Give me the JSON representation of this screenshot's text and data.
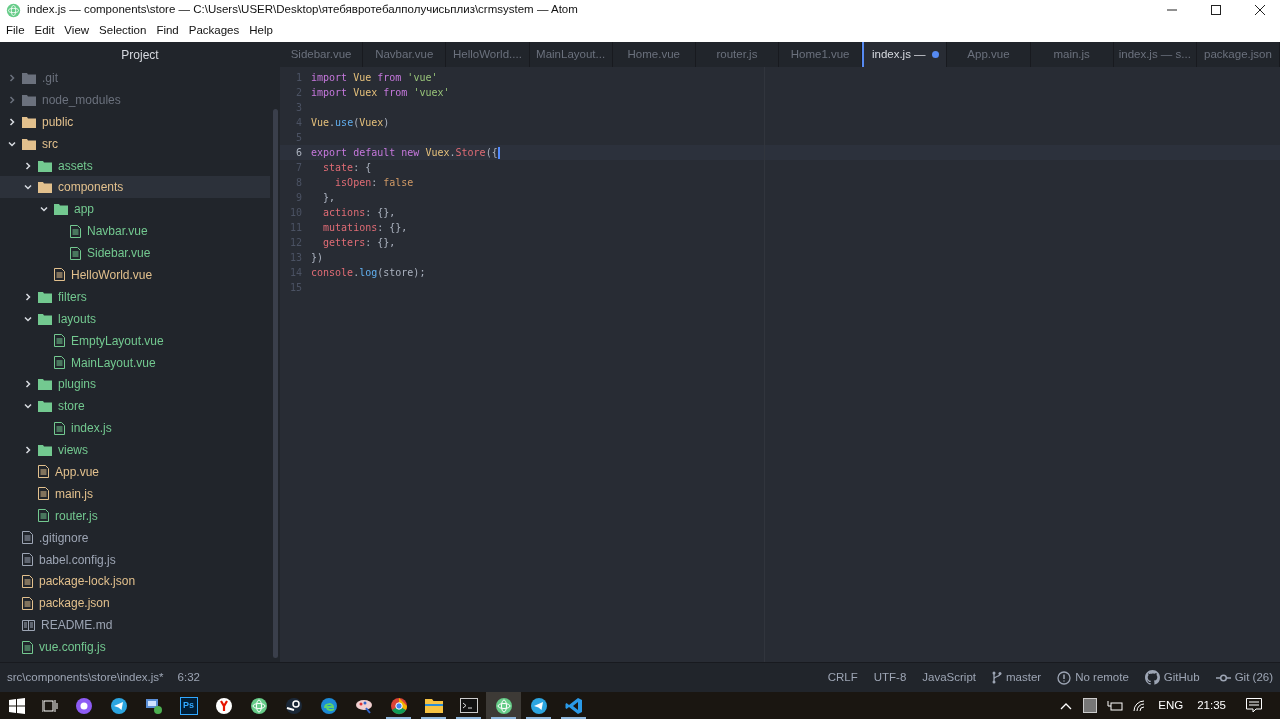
{
  "window": {
    "title": "index.js — components\\store — C:\\Users\\USER\\Desktop\\ятебявротебалполучисьплиз\\crmsystem — Atom"
  },
  "menu": [
    "File",
    "Edit",
    "View",
    "Selection",
    "Find",
    "Packages",
    "Help"
  ],
  "sidebar": {
    "title": "Project",
    "tree": [
      {
        "name": ".git",
        "kind": "folder",
        "color": "#6b717d",
        "expanded": false,
        "selected": false
      },
      {
        "name": "node_modules",
        "kind": "folder",
        "color": "#6b717d",
        "expanded": false,
        "selected": false
      },
      {
        "name": "public",
        "kind": "folder",
        "color": "#e2c08d",
        "expanded": false,
        "selected": false
      },
      {
        "name": "src",
        "kind": "folder",
        "color": "#e2c08d",
        "expanded": true,
        "selected": false,
        "children": [
          {
            "name": "assets",
            "kind": "folder",
            "color": "#73c990",
            "expanded": false,
            "selected": false
          },
          {
            "name": "components",
            "kind": "folder",
            "color": "#e2c08d",
            "expanded": true,
            "selected": true,
            "children": [
              {
                "name": "app",
                "kind": "folder",
                "color": "#73c990",
                "expanded": true,
                "selected": false,
                "children": [
                  {
                    "name": "Navbar.vue",
                    "kind": "file",
                    "color": "#73c990",
                    "selected": false
                  },
                  {
                    "name": "Sidebar.vue",
                    "kind": "file",
                    "color": "#73c990",
                    "selected": false
                  }
                ]
              },
              {
                "name": "HelloWorld.vue",
                "kind": "file",
                "color": "#e2c08d",
                "selected": false
              }
            ]
          },
          {
            "name": "filters",
            "kind": "folder",
            "color": "#73c990",
            "expanded": false,
            "selected": false
          },
          {
            "name": "layouts",
            "kind": "folder",
            "color": "#73c990",
            "expanded": true,
            "selected": false,
            "children": [
              {
                "name": "EmptyLayout.vue",
                "kind": "file",
                "color": "#73c990",
                "selected": false
              },
              {
                "name": "MainLayout.vue",
                "kind": "file",
                "color": "#73c990",
                "selected": false
              }
            ]
          },
          {
            "name": "plugins",
            "kind": "folder",
            "color": "#73c990",
            "expanded": false,
            "selected": false
          },
          {
            "name": "store",
            "kind": "folder",
            "color": "#73c990",
            "expanded": true,
            "selected": false,
            "children": [
              {
                "name": "index.js",
                "kind": "file",
                "color": "#73c990",
                "selected": false
              }
            ]
          },
          {
            "name": "views",
            "kind": "folder",
            "color": "#73c990",
            "expanded": false,
            "selected": false
          },
          {
            "name": "App.vue",
            "kind": "file",
            "color": "#e2c08d",
            "selected": false
          },
          {
            "name": "main.js",
            "kind": "file",
            "color": "#e2c08d",
            "selected": false
          },
          {
            "name": "router.js",
            "kind": "file",
            "color": "#73c990",
            "selected": false
          }
        ]
      },
      {
        "name": ".gitignore",
        "kind": "file",
        "color": "#9da5b4",
        "selected": false
      },
      {
        "name": "babel.config.js",
        "kind": "file",
        "color": "#9da5b4",
        "selected": false
      },
      {
        "name": "package-lock.json",
        "kind": "file",
        "color": "#e2c08d",
        "selected": false
      },
      {
        "name": "package.json",
        "kind": "file",
        "color": "#e2c08d",
        "selected": false
      },
      {
        "name": "README.md",
        "kind": "readme",
        "color": "#9da5b4",
        "selected": false
      },
      {
        "name": "vue.config.js",
        "kind": "file",
        "color": "#73c990",
        "selected": false
      }
    ]
  },
  "tabs": [
    {
      "label": "Sidebar.vue",
      "selected": false,
      "modified": false
    },
    {
      "label": "Navbar.vue",
      "selected": false,
      "modified": false
    },
    {
      "label": "HelloWorld....",
      "selected": false,
      "modified": false
    },
    {
      "label": "MainLayout...",
      "selected": false,
      "modified": false
    },
    {
      "label": "Home.vue",
      "selected": false,
      "modified": false
    },
    {
      "label": "router.js",
      "selected": false,
      "modified": false
    },
    {
      "label": "Home1.vue",
      "selected": false,
      "modified": false
    },
    {
      "label": "index.js —",
      "selected": true,
      "modified": true
    },
    {
      "label": "App.vue",
      "selected": false,
      "modified": false
    },
    {
      "label": "main.js",
      "selected": false,
      "modified": false
    },
    {
      "label": "index.js — s...",
      "selected": false,
      "modified": false
    },
    {
      "label": "package.json",
      "selected": false,
      "modified": false
    }
  ],
  "editor": {
    "lines": [
      {
        "number": "1",
        "current": false,
        "tokens": [
          {
            "kind": "keyword",
            "text": "import "
          },
          {
            "kind": "class",
            "text": "Vue "
          },
          {
            "kind": "keyword",
            "text": "from "
          },
          {
            "kind": "string",
            "text": "'vue'"
          }
        ]
      },
      {
        "number": "2",
        "current": false,
        "tokens": [
          {
            "kind": "keyword",
            "text": "import "
          },
          {
            "kind": "class",
            "text": "Vuex "
          },
          {
            "kind": "keyword",
            "text": "from "
          },
          {
            "kind": "string",
            "text": "'vuex'"
          }
        ]
      },
      {
        "number": "3",
        "current": false
      },
      {
        "number": "4",
        "current": false,
        "tokens": [
          {
            "kind": "class",
            "text": "Vue"
          },
          {
            "kind": "plain",
            "text": "."
          },
          {
            "kind": "function",
            "text": "use"
          },
          {
            "kind": "plain",
            "text": "("
          },
          {
            "kind": "class",
            "text": "Vuex"
          },
          {
            "kind": "plain",
            "text": ")"
          }
        ]
      },
      {
        "number": "5",
        "current": false
      },
      {
        "number": "6",
        "current": true,
        "tokens": [
          {
            "kind": "keyword",
            "text": "export default new "
          },
          {
            "kind": "class",
            "text": "Vuex"
          },
          {
            "kind": "plain",
            "text": "."
          },
          {
            "kind": "property",
            "text": "Store"
          },
          {
            "kind": "plain",
            "text": "({"
          }
        ]
      },
      {
        "number": "7",
        "current": false,
        "tokens": [
          {
            "kind": "property",
            "text": "  state"
          },
          {
            "kind": "plain",
            "text": ": {"
          }
        ]
      },
      {
        "number": "8",
        "current": false,
        "tokens": [
          {
            "kind": "property",
            "text": "    isOpen"
          },
          {
            "kind": "plain",
            "text": ": "
          },
          {
            "kind": "boolean",
            "text": "false"
          }
        ]
      },
      {
        "number": "9",
        "current": false,
        "tokens": [
          {
            "kind": "plain",
            "text": "  },"
          }
        ]
      },
      {
        "number": "10",
        "current": false,
        "tokens": [
          {
            "kind": "property",
            "text": "  actions"
          },
          {
            "kind": "plain",
            "text": ": {},"
          }
        ]
      },
      {
        "number": "11",
        "current": false,
        "tokens": [
          {
            "kind": "property",
            "text": "  mutations"
          },
          {
            "kind": "plain",
            "text": ": {},"
          }
        ]
      },
      {
        "number": "12",
        "current": false,
        "tokens": [
          {
            "kind": "property",
            "text": "  getters"
          },
          {
            "kind": "plain",
            "text": ": {},"
          }
        ]
      },
      {
        "number": "13",
        "current": false,
        "tokens": [
          {
            "kind": "plain",
            "text": "})"
          }
        ]
      },
      {
        "number": "14",
        "current": false,
        "tokens": [
          {
            "kind": "property",
            "text": "console"
          },
          {
            "kind": "plain",
            "text": "."
          },
          {
            "kind": "function",
            "text": "log"
          },
          {
            "kind": "plain",
            "text": "(store);"
          }
        ]
      },
      {
        "number": "15",
        "current": false
      }
    ]
  },
  "status_bar": {
    "path": "src\\components\\store\\index.js*",
    "cursor": "6:32",
    "items": [
      {
        "kind": "plain",
        "text": "CRLF"
      },
      {
        "kind": "plain",
        "text": "UTF-8"
      },
      {
        "kind": "plain",
        "text": "JavaScript"
      },
      {
        "kind": "branch",
        "text": "master"
      },
      {
        "kind": "warning",
        "text": "No remote"
      },
      {
        "kind": "github",
        "text": "GitHub"
      },
      {
        "kind": "git",
        "text": "Git (26)"
      }
    ]
  },
  "taskbar": {
    "apps": [
      {
        "kind": "assistant",
        "running": false,
        "active": false
      },
      {
        "kind": "telegram",
        "running": false,
        "active": false
      },
      {
        "kind": "remote",
        "running": false,
        "active": false
      },
      {
        "kind": "photoshop",
        "label": "Ps",
        "running": false,
        "active": false
      },
      {
        "kind": "yandex",
        "running": false,
        "active": false
      },
      {
        "kind": "atom",
        "running": false,
        "active": false
      },
      {
        "kind": "steam",
        "running": false,
        "active": false
      },
      {
        "kind": "edge",
        "running": false,
        "active": false
      },
      {
        "kind": "paint",
        "running": false,
        "active": false
      },
      {
        "kind": "chrome",
        "running": true,
        "active": false
      },
      {
        "kind": "explorer",
        "running": true,
        "active": false
      },
      {
        "kind": "terminal",
        "running": true,
        "active": false
      },
      {
        "kind": "atom",
        "running": true,
        "active": true
      },
      {
        "kind": "telegram",
        "running": true,
        "active": false
      },
      {
        "kind": "vscode",
        "running": true,
        "active": false
      }
    ],
    "language": "ENG",
    "time": "21:35"
  }
}
